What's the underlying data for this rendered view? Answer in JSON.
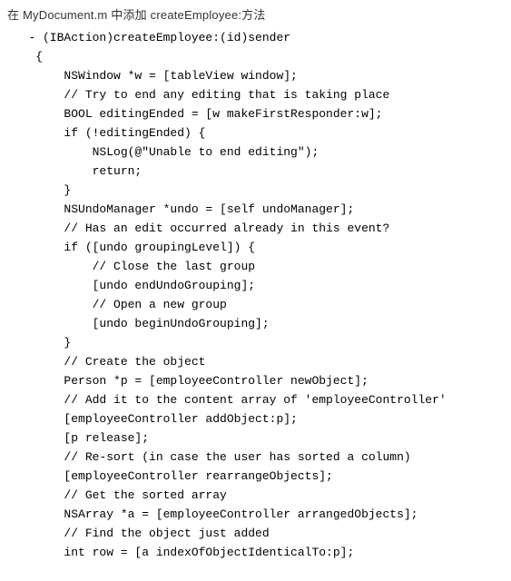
{
  "intro": "在 MyDocument.m 中添加 createEmployee:方法",
  "code": "   - (IBAction)createEmployee:(id)sender\n    {\n        NSWindow *w = [tableView window];\n        // Try to end any editing that is taking place\n        BOOL editingEnded = [w makeFirstResponder:w];\n        if (!editingEnded) {\n            NSLog(@\"Unable to end editing\");\n            return;\n        }\n        NSUndoManager *undo = [self undoManager];\n        // Has an edit occurred already in this event?\n        if ([undo groupingLevel]) {\n            // Close the last group\n            [undo endUndoGrouping];\n            // Open a new group\n            [undo beginUndoGrouping];\n        }\n        // Create the object\n        Person *p = [employeeController newObject];\n        // Add it to the content array of 'employeeController'\n        [employeeController addObject:p];\n        [p release];\n        // Re-sort (in case the user has sorted a column)\n        [employeeController rearrangeObjects];\n        // Get the sorted array\n        NSArray *a = [employeeController arrangedObjects];\n        // Find the object just added\n        int row = [a indexOfObjectIdenticalTo:p];"
}
